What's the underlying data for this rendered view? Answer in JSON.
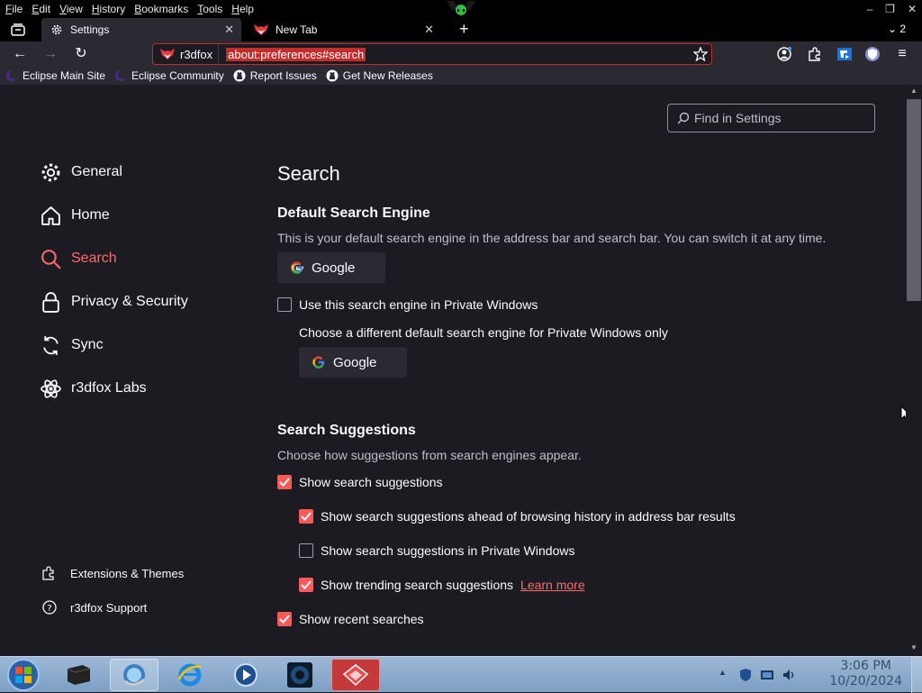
{
  "menubar": {
    "items": [
      "File",
      "Edit",
      "View",
      "History",
      "Bookmarks",
      "Tools",
      "Help"
    ],
    "window_count": "2"
  },
  "tabs": [
    {
      "label": "Settings"
    },
    {
      "label": "New Tab"
    }
  ],
  "urlbar": {
    "identity": "r3dfox",
    "url": "about:preferences#search"
  },
  "bookmarks": [
    "Eclipse Main Site",
    "Eclipse Community",
    "Report Issues",
    "Get New Releases"
  ],
  "find": {
    "placeholder": "Find in Settings"
  },
  "sidebar": {
    "items": [
      {
        "label": "General",
        "icon": "gear-icon"
      },
      {
        "label": "Home",
        "icon": "home-icon"
      },
      {
        "label": "Search",
        "icon": "search-icon",
        "active": true
      },
      {
        "label": "Privacy & Security",
        "icon": "lock-icon"
      },
      {
        "label": "Sync",
        "icon": "sync-icon"
      },
      {
        "label": "r3dfox Labs",
        "icon": "labs-icon"
      }
    ],
    "footer": [
      {
        "label": "Extensions & Themes",
        "icon": "puzzle-icon"
      },
      {
        "label": "r3dfox Support",
        "icon": "help-icon"
      }
    ]
  },
  "main": {
    "title": "Search",
    "default_engine": {
      "heading": "Default Search Engine",
      "description": "This is your default search engine in the address bar and search bar. You can switch it at any time.",
      "engine": "Google",
      "private_checkbox": "Use this search engine in Private Windows",
      "private_desc": "Choose a different default search engine for Private Windows only",
      "private_engine": "Google"
    },
    "suggestions": {
      "heading": "Search Suggestions",
      "description": "Choose how suggestions from search engines appear.",
      "show": "Show search suggestions",
      "ahead": "Show search suggestions ahead of browsing history in address bar results",
      "private": "Show search suggestions in Private Windows",
      "trending": "Show trending search suggestions",
      "learn_more": "Learn more",
      "recent": "Show recent searches"
    }
  },
  "taskbar": {
    "time": "3:06 PM",
    "date": "10/20/2024"
  },
  "colors": {
    "accent": "#ff6a6a",
    "background": "#1c1b22",
    "toolbar": "#2b2a33"
  }
}
